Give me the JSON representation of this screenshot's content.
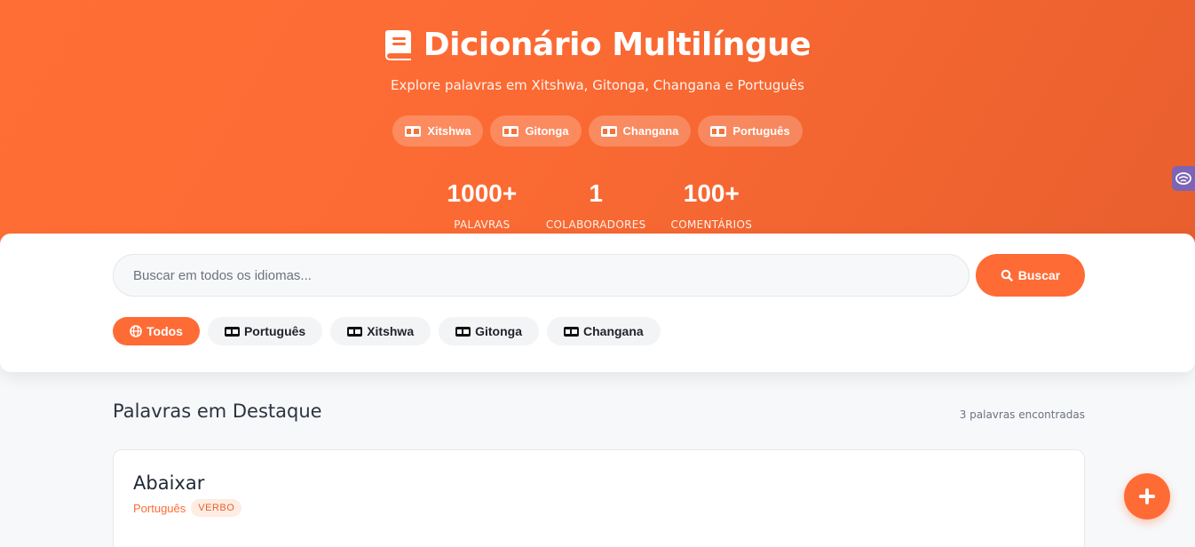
{
  "header": {
    "title": "Dicionário Multilíngue",
    "subtitle": "Explore palavras em Xitshwa, Gitonga, Changana e Português",
    "languages": [
      {
        "label": "Xitshwa",
        "icon": "language-icon"
      },
      {
        "label": "Gitonga",
        "icon": "language-icon"
      },
      {
        "label": "Changana",
        "icon": "language-icon"
      },
      {
        "label": "Português",
        "icon": "language-icon"
      }
    ],
    "stats": [
      {
        "value": "1000+",
        "label": "PALAVRAS"
      },
      {
        "value": "1",
        "label": "COLABORADORES"
      },
      {
        "value": "100+",
        "label": "COMENTÁRIOS"
      }
    ]
  },
  "search": {
    "placeholder": "Buscar em todos os idiomas...",
    "button_label": "Buscar",
    "filters": [
      {
        "label": "Todos",
        "icon": "globe-icon",
        "active": true
      },
      {
        "label": "Português",
        "icon": "language-icon",
        "active": false
      },
      {
        "label": "Xitshwa",
        "icon": "language-icon",
        "active": false
      },
      {
        "label": "Gitonga",
        "icon": "language-icon",
        "active": false
      },
      {
        "label": "Changana",
        "icon": "language-icon",
        "active": false
      }
    ]
  },
  "featured": {
    "title": "Palavras em Destaque",
    "count": "3 palavras encontradas",
    "words": [
      {
        "word": "Abaixar",
        "language": "Português",
        "class": "VERBO"
      }
    ]
  },
  "colors": {
    "accent": "#ff6b35",
    "side_tab": "#7d64b4"
  }
}
